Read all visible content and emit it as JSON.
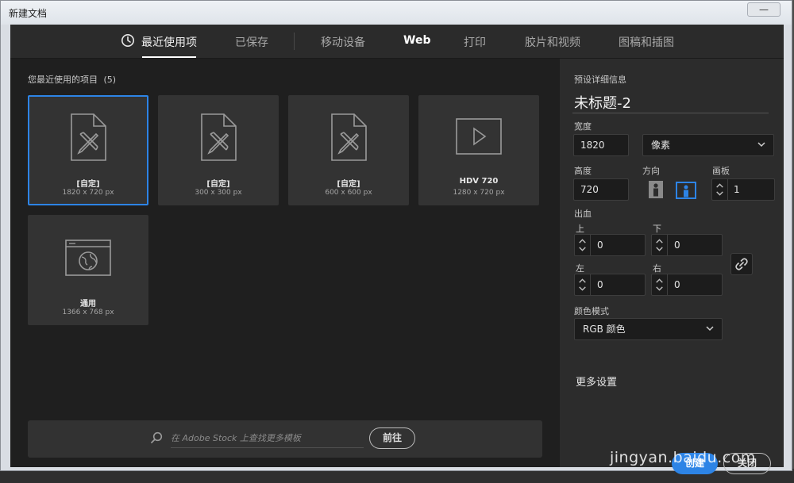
{
  "window": {
    "title": "新建文档",
    "close_label": "—"
  },
  "tabs": [
    {
      "label": "最近使用项",
      "active": true
    },
    {
      "label": "已保存"
    },
    {
      "label": "移动设备"
    },
    {
      "label": "Web"
    },
    {
      "label": "打印"
    },
    {
      "label": "胶片和视频"
    },
    {
      "label": "图稿和插图"
    }
  ],
  "recent": {
    "title": "您最近使用的项目",
    "count": "(5)",
    "items": [
      {
        "name": "[自定]",
        "size": "1820 x 720 px",
        "icon": "document-pen-icon",
        "selected": true
      },
      {
        "name": "[自定]",
        "size": "300 x 300 px",
        "icon": "document-pen-icon"
      },
      {
        "name": "[自定]",
        "size": "600 x 600 px",
        "icon": "document-pen-icon"
      },
      {
        "name": "HDV 720",
        "size": "1280 x 720 px",
        "icon": "video-play-icon"
      },
      {
        "name": "通用",
        "size": "1366 x 768 px",
        "icon": "web-globe-icon"
      }
    ]
  },
  "stock": {
    "placeholder": "在 Adobe Stock 上查找更多模板",
    "go_label": "前往"
  },
  "preset": {
    "section_title": "预设详细信息",
    "doc_name": "未标题-2",
    "width_label": "宽度",
    "width_value": "1820",
    "unit": "像素",
    "height_label": "高度",
    "height_value": "720",
    "orientation_label": "方向",
    "artboard_label": "画板",
    "artboard_value": "1",
    "bleed_label": "出血",
    "bleed_top_label": "上",
    "bleed_top": "0",
    "bleed_bottom_label": "下",
    "bleed_bottom": "0",
    "bleed_left_label": "左",
    "bleed_left": "0",
    "bleed_right_label": "右",
    "bleed_right": "0",
    "color_mode_label": "颜色模式",
    "color_mode": "RGB 颜色",
    "more_settings": "更多设置",
    "create_label": "创建",
    "cancel_label": "关闭"
  },
  "watermark": {
    "domain": "jingyan.baidu.com"
  },
  "colors": {
    "accent": "#2d84e6",
    "panel": "#2c2c2c",
    "background": "#1f1f1f"
  }
}
